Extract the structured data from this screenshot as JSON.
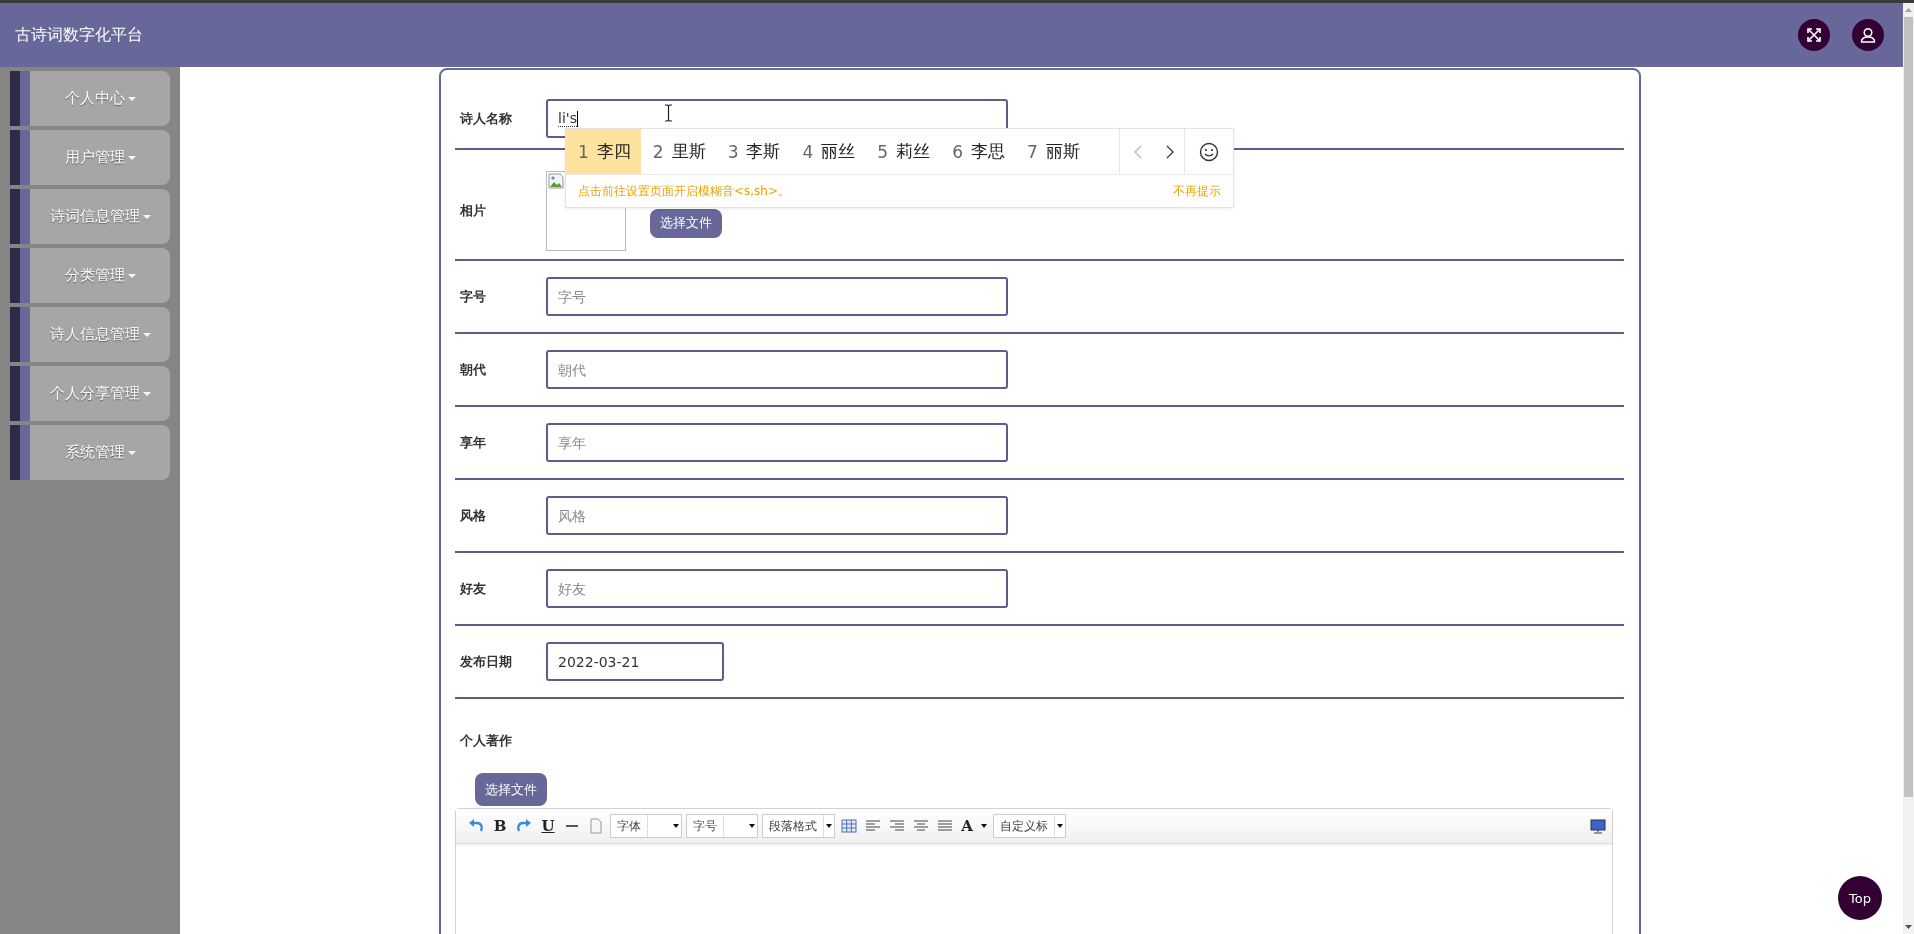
{
  "header": {
    "title": "古诗词数字化平台"
  },
  "sidebar": {
    "items": [
      {
        "label": "个人中心"
      },
      {
        "label": "用户管理"
      },
      {
        "label": "诗词信息管理"
      },
      {
        "label": "分类管理"
      },
      {
        "label": "诗人信息管理"
      },
      {
        "label": "个人分享管理"
      },
      {
        "label": "系统管理"
      }
    ]
  },
  "form": {
    "fields": [
      {
        "kind": "text",
        "label": "诗人名称",
        "value": "li's",
        "composing": true
      },
      {
        "kind": "image",
        "label": "相片",
        "button": "选择文件"
      },
      {
        "kind": "text",
        "label": "字号",
        "placeholder": "字号"
      },
      {
        "kind": "text",
        "label": "朝代",
        "placeholder": "朝代"
      },
      {
        "kind": "text",
        "label": "享年",
        "placeholder": "享年"
      },
      {
        "kind": "text",
        "label": "风格",
        "placeholder": "风格"
      },
      {
        "kind": "text",
        "label": "好友",
        "placeholder": "好友"
      },
      {
        "kind": "date",
        "label": "发布日期",
        "value": "2022-03-21"
      },
      {
        "kind": "editor",
        "label": "个人著作",
        "button": "选择文件"
      }
    ]
  },
  "editor": {
    "toolbar": [
      {
        "kind": "undo"
      },
      {
        "kind": "bold",
        "text": "B"
      },
      {
        "kind": "redo"
      },
      {
        "kind": "underline",
        "text": "U"
      },
      {
        "kind": "rule"
      },
      {
        "kind": "page"
      },
      {
        "kind": "select",
        "text": "字体"
      },
      {
        "kind": "select",
        "text": "字号"
      },
      {
        "kind": "select",
        "text": "段落格式"
      },
      {
        "kind": "table"
      },
      {
        "kind": "align-left"
      },
      {
        "kind": "align-right"
      },
      {
        "kind": "align-center"
      },
      {
        "kind": "justify"
      },
      {
        "kind": "color",
        "text": "A"
      },
      {
        "kind": "select",
        "text": "自定义标"
      }
    ]
  },
  "ime": {
    "candidates": [
      {
        "index": "1",
        "text": "李四",
        "selected": true
      },
      {
        "index": "2",
        "text": "里斯",
        "selected": false
      },
      {
        "index": "3",
        "text": "李斯",
        "selected": false
      },
      {
        "index": "4",
        "text": "丽丝",
        "selected": false
      },
      {
        "index": "5",
        "text": "莉丝",
        "selected": false
      },
      {
        "index": "6",
        "text": "李思",
        "selected": false
      },
      {
        "index": "7",
        "text": "丽斯",
        "selected": false
      }
    ],
    "hint": "点击前往设置页面开启模糊音<s,sh>。",
    "dismiss": "不再提示"
  },
  "top_button": {
    "label": "Top"
  }
}
